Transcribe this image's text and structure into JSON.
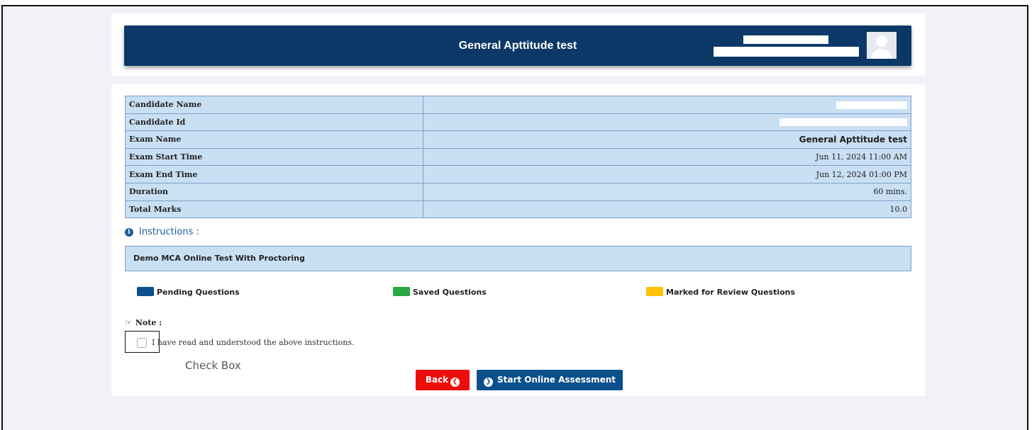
{
  "header": {
    "title": "General Apttitude test"
  },
  "candidate_info": {
    "rows": [
      {
        "label": "Candidate Name",
        "value": ""
      },
      {
        "label": "Candidate Id",
        "value": ""
      },
      {
        "label": "Exam Name",
        "value": "General Apttitude test"
      },
      {
        "label": "Exam Start Time",
        "value": "Jun 11, 2024 11:00 AM"
      },
      {
        "label": "Exam End Time",
        "value": "Jun 12, 2024 01:00 PM"
      },
      {
        "label": "Duration",
        "value": "60 mins."
      },
      {
        "label": "Total Marks",
        "value": "10.0"
      }
    ]
  },
  "instructions": {
    "heading": "Instructions :",
    "text": "Demo MCA Online Test With Proctoring"
  },
  "legend": {
    "pending": {
      "label": "Pending Questions",
      "color": "#0d4f8b"
    },
    "saved": {
      "label": "Saved Questions",
      "color": "#27a845"
    },
    "review": {
      "label": "Marked for Review Questions",
      "color": "#ffc107"
    }
  },
  "note": {
    "label": "Note :",
    "icon": "hand-point-right-icon"
  },
  "agreement": {
    "text": "I have read and understood the above instructions.",
    "checked": false,
    "caption": "Check Box"
  },
  "buttons": {
    "back": "Back",
    "start": "Start Online Assessment"
  },
  "colors": {
    "header_bg": "#0b3866",
    "table_bg": "#c9dff3",
    "back_button": "#ee0d0d",
    "start_button": "#0b4f8c",
    "instructions_text": "#1f5e9a"
  }
}
